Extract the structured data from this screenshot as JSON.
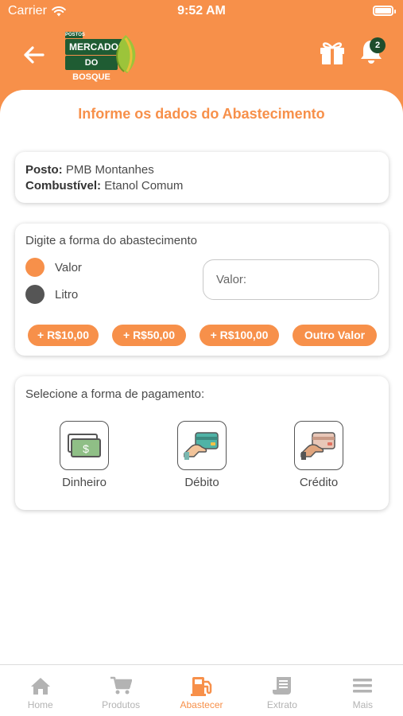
{
  "status_bar": {
    "carrier": "Carrier",
    "time": "9:52 AM"
  },
  "header": {
    "logo_lines": [
      "POSTOS",
      "MERCADO",
      "DO BOSQUE"
    ],
    "notification_count": "2"
  },
  "page_title": "Informe os dados do Abastecimento",
  "posto_card": {
    "posto_label": "Posto:",
    "posto_value": "PMB Montanhes",
    "combustivel_label": "Combustível:",
    "combustivel_value": "Etanol Comum"
  },
  "abastecimento": {
    "label": "Digite a forma do abastecimento",
    "options": [
      {
        "label": "Valor",
        "selected": true
      },
      {
        "label": "Litro",
        "selected": false
      }
    ],
    "input_placeholder": "Valor:",
    "chips": [
      "+ R$10,00",
      "+ R$50,00",
      "+ R$100,00",
      "Outro Valor"
    ]
  },
  "pagamento": {
    "label": "Selecione a forma de pagamento:",
    "options": [
      {
        "label": "Dinheiro",
        "icon": "cash-icon"
      },
      {
        "label": "Débito",
        "icon": "debit-card-icon"
      },
      {
        "label": "Crédito",
        "icon": "credit-card-icon"
      }
    ]
  },
  "tab_bar": {
    "items": [
      {
        "label": "Home",
        "icon": "home-icon",
        "active": false
      },
      {
        "label": "Produtos",
        "icon": "cart-icon",
        "active": false
      },
      {
        "label": "Abastecer",
        "icon": "fuel-pump-icon",
        "active": true
      },
      {
        "label": "Extrato",
        "icon": "receipt-icon",
        "active": false
      },
      {
        "label": "Mais",
        "icon": "menu-icon",
        "active": false
      }
    ]
  },
  "colors": {
    "accent": "#F7904A",
    "selected_radio": "#F7904A",
    "unselected_radio": "#555555",
    "logo_green": "#1F5C33",
    "inactive_tab": "#B3B3B3"
  }
}
